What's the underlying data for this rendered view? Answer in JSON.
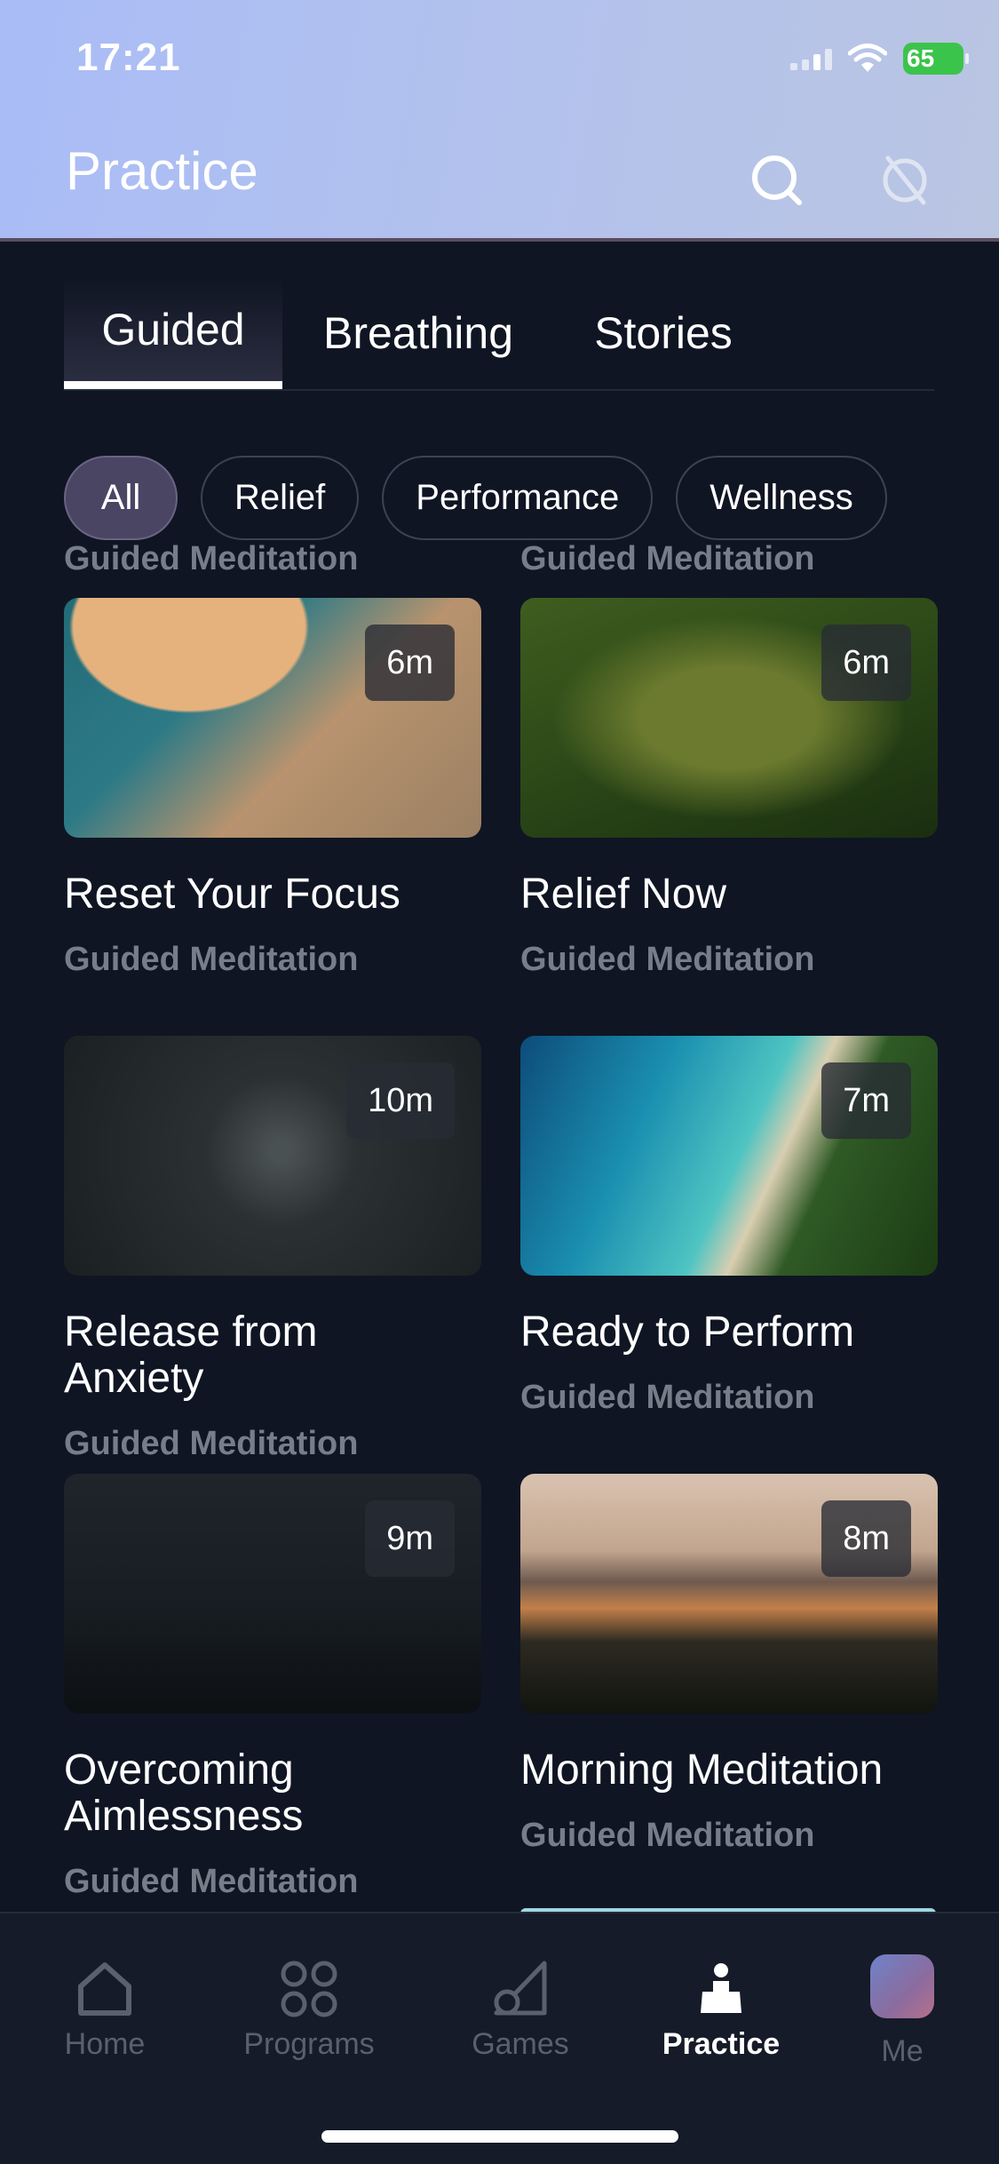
{
  "status_bar": {
    "time": "17:21",
    "battery": "65"
  },
  "header": {
    "title": "Practice"
  },
  "tabs": [
    {
      "label": "Guided",
      "active": true
    },
    {
      "label": "Breathing",
      "active": false
    },
    {
      "label": "Stories",
      "active": false
    }
  ],
  "filters": [
    {
      "label": "All",
      "active": true
    },
    {
      "label": "Relief",
      "active": false
    },
    {
      "label": "Performance",
      "active": false
    },
    {
      "label": "Wellness",
      "active": false
    }
  ],
  "clipped_subtitles": [
    "Guided Meditation",
    "Guided Meditation"
  ],
  "cards": [
    {
      "title": "Reset Your Focus",
      "subtitle": "Guided Meditation",
      "duration": "6m"
    },
    {
      "title": "Relief Now",
      "subtitle": "Guided Meditation",
      "duration": "6m"
    },
    {
      "title": "Release from Anxiety",
      "subtitle": "Guided Meditation",
      "duration": "10m"
    },
    {
      "title": "Ready to Perform",
      "subtitle": "Guided Meditation",
      "duration": "7m"
    },
    {
      "title": "Overcoming Aimlessness",
      "subtitle": "Guided Meditation",
      "duration": "9m"
    },
    {
      "title": "Morning Meditation",
      "subtitle": "Guided Meditation",
      "duration": "8m"
    }
  ],
  "bottom_nav": [
    {
      "label": "Home",
      "icon": "home-icon",
      "active": false
    },
    {
      "label": "Programs",
      "icon": "programs-icon",
      "active": false
    },
    {
      "label": "Games",
      "icon": "games-icon",
      "active": false
    },
    {
      "label": "Practice",
      "icon": "practice-icon",
      "active": true
    },
    {
      "label": "Me",
      "icon": "avatar",
      "active": false
    }
  ]
}
